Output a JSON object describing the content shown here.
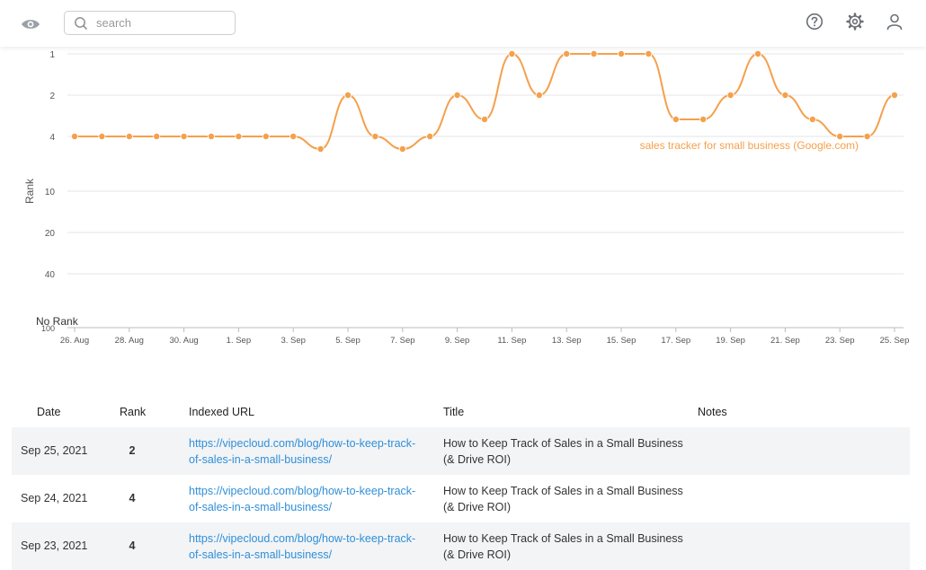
{
  "search": {
    "placeholder": "search",
    "value": ""
  },
  "icons": {
    "eye": "eye-icon",
    "search": "search-icon",
    "help": "help-circle-icon",
    "settings": "gear-icon",
    "user": "user-icon"
  },
  "colors": {
    "series": "#f5a04c",
    "link": "#2f8fd8",
    "row_alt": "#f3f4f6"
  },
  "chart_data": {
    "type": "line",
    "ylabel": "Rank",
    "y_scale": "log",
    "y_ticks": [
      {
        "value": 1,
        "label": "1"
      },
      {
        "value": 2,
        "label": "2"
      },
      {
        "value": 4,
        "label": "4"
      },
      {
        "value": 10,
        "label": "10"
      },
      {
        "value": 20,
        "label": "20"
      },
      {
        "value": 40,
        "label": "40"
      },
      {
        "value": 100,
        "label": "100"
      }
    ],
    "no_rank_label": "No Rank",
    "y_inverted": true,
    "x_tick_labels": [
      "26. Aug",
      "28. Aug",
      "30. Aug",
      "1. Sep",
      "3. Sep",
      "5. Sep",
      "7. Sep",
      "9. Sep",
      "11. Sep",
      "13. Sep",
      "15. Sep",
      "17. Sep",
      "19. Sep",
      "21. Sep",
      "23. Sep",
      "25. Sep"
    ],
    "series": [
      {
        "name": "sales tracker for small business (Google.com)",
        "color": "#f5a04c",
        "x": [
          "26. Aug",
          "27. Aug",
          "28. Aug",
          "29. Aug",
          "30. Aug",
          "31. Aug",
          "1. Sep",
          "2. Sep",
          "3. Sep",
          "4. Sep",
          "5. Sep",
          "6. Sep",
          "7. Sep",
          "8. Sep",
          "9. Sep",
          "10. Sep",
          "11. Sep",
          "12. Sep",
          "13. Sep",
          "14. Sep",
          "15. Sep",
          "16. Sep",
          "17. Sep",
          "18. Sep",
          "19. Sep",
          "20. Sep",
          "21. Sep",
          "22. Sep",
          "23. Sep",
          "24. Sep",
          "25. Sep"
        ],
        "values": [
          4,
          4,
          4,
          4,
          4,
          4,
          4,
          4,
          4,
          5,
          2,
          4,
          5,
          4,
          2,
          3,
          1,
          2,
          1,
          1,
          1,
          1,
          3,
          3,
          2,
          1,
          2,
          3,
          4,
          4,
          2
        ]
      }
    ]
  },
  "table": {
    "headers": {
      "date": "Date",
      "rank": "Rank",
      "url": "Indexed URL",
      "title": "Title",
      "notes": "Notes"
    },
    "rows": [
      {
        "date": "Sep 25, 2021",
        "rank": "2",
        "url": "https://vipecloud.com/blog/how-to-keep-track-of-sales-in-a-small-business/",
        "title": "How to Keep Track of Sales in a Small Business (& Drive ROI)",
        "notes": ""
      },
      {
        "date": "Sep 24, 2021",
        "rank": "4",
        "url": "https://vipecloud.com/blog/how-to-keep-track-of-sales-in-a-small-business/",
        "title": "How to Keep Track of Sales in a Small Business (& Drive ROI)",
        "notes": ""
      },
      {
        "date": "Sep 23, 2021",
        "rank": "4",
        "url": "https://vipecloud.com/blog/how-to-keep-track-of-sales-in-a-small-business/",
        "title": "How to Keep Track of Sales in a Small Business (& Drive ROI)",
        "notes": ""
      }
    ]
  }
}
